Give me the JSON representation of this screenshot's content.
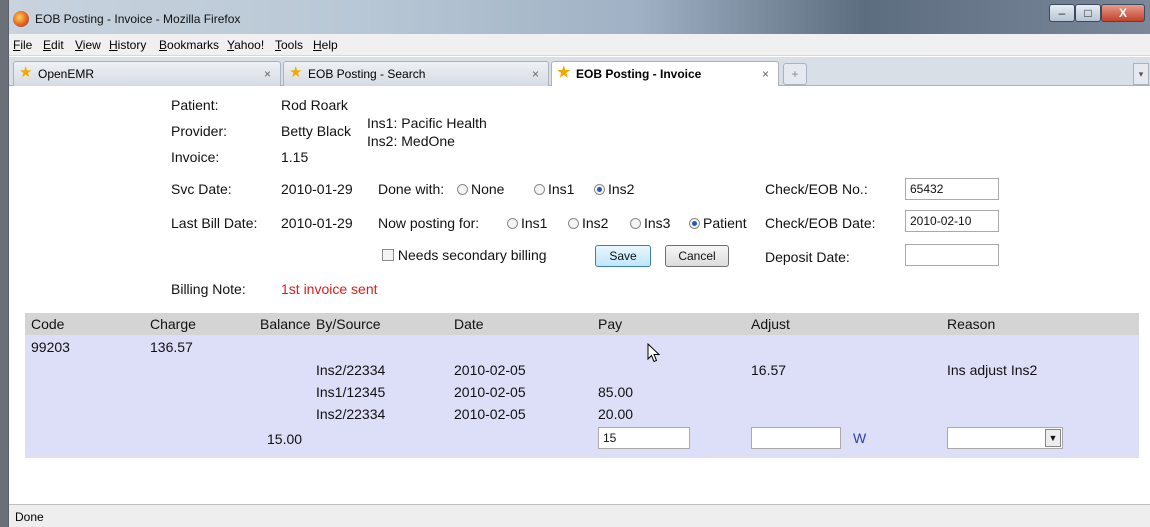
{
  "window": {
    "title": "EOB Posting - Invoice - Mozilla Firefox",
    "min": "–",
    "max": "□",
    "close": "X"
  },
  "menu": [
    "File",
    "Edit",
    "View",
    "History",
    "Bookmarks",
    "Yahoo!",
    "Tools",
    "Help"
  ],
  "tabs": [
    {
      "label": "OpenEMR",
      "close": "×"
    },
    {
      "label": "EOB Posting - Search",
      "close": "×"
    },
    {
      "label": "EOB Posting - Invoice",
      "close": "×"
    }
  ],
  "new_tab": "+",
  "invoice": {
    "patient_label": "Patient:",
    "patient": "Rod Roark",
    "provider_label": "Provider:",
    "provider": "Betty Black",
    "ins1": "Ins1: Pacific Health",
    "ins2": "Ins2: MedOne",
    "invoice_label": "Invoice:",
    "invoice": "1.15",
    "svc_date_label": "Svc Date:",
    "svc_date": "2010-01-29",
    "last_bill_label": "Last Bill Date:",
    "last_bill_date": "2010-01-29",
    "done_with_label": "Done with:",
    "done_with_options": [
      "None",
      "Ins1",
      "Ins2"
    ],
    "done_with_selected": "Ins2",
    "posting_label": "Now posting for:",
    "posting_options": [
      "Ins1",
      "Ins2",
      "Ins3",
      "Patient"
    ],
    "posting_selected": "Patient",
    "secondary_label": "Needs secondary billing",
    "save_label": "Save",
    "cancel_label": "Cancel",
    "check_no_label": "Check/EOB No.:",
    "check_no": "65432",
    "check_date_label": "Check/EOB Date:",
    "check_date": "2010-02-10",
    "deposit_label": "Deposit Date:",
    "deposit_date": "",
    "billing_note_label": "Billing Note:",
    "billing_note": "1st invoice sent",
    "note_color": "#e01b1b"
  },
  "table": {
    "headers": [
      "Code",
      "Charge",
      "Balance",
      "By/Source",
      "Date",
      "Pay",
      "Adjust",
      "Reason"
    ],
    "code_row": {
      "code": "99203",
      "charge": "136.57"
    },
    "rows": [
      {
        "source": "Ins2/22334",
        "date": "2010-02-05",
        "pay": "",
        "adjust": "16.57",
        "reason": "Ins adjust Ins2"
      },
      {
        "source": "Ins1/12345",
        "date": "2010-02-05",
        "pay": "85.00",
        "adjust": "",
        "reason": ""
      },
      {
        "source": "Ins2/22334",
        "date": "2010-02-05",
        "pay": "20.00",
        "adjust": "",
        "reason": ""
      }
    ],
    "balance": "15.00",
    "pay_input": "15",
    "adjust_input": "",
    "w_label": "W",
    "w_color": "#2a3fb3"
  },
  "status": "Done"
}
